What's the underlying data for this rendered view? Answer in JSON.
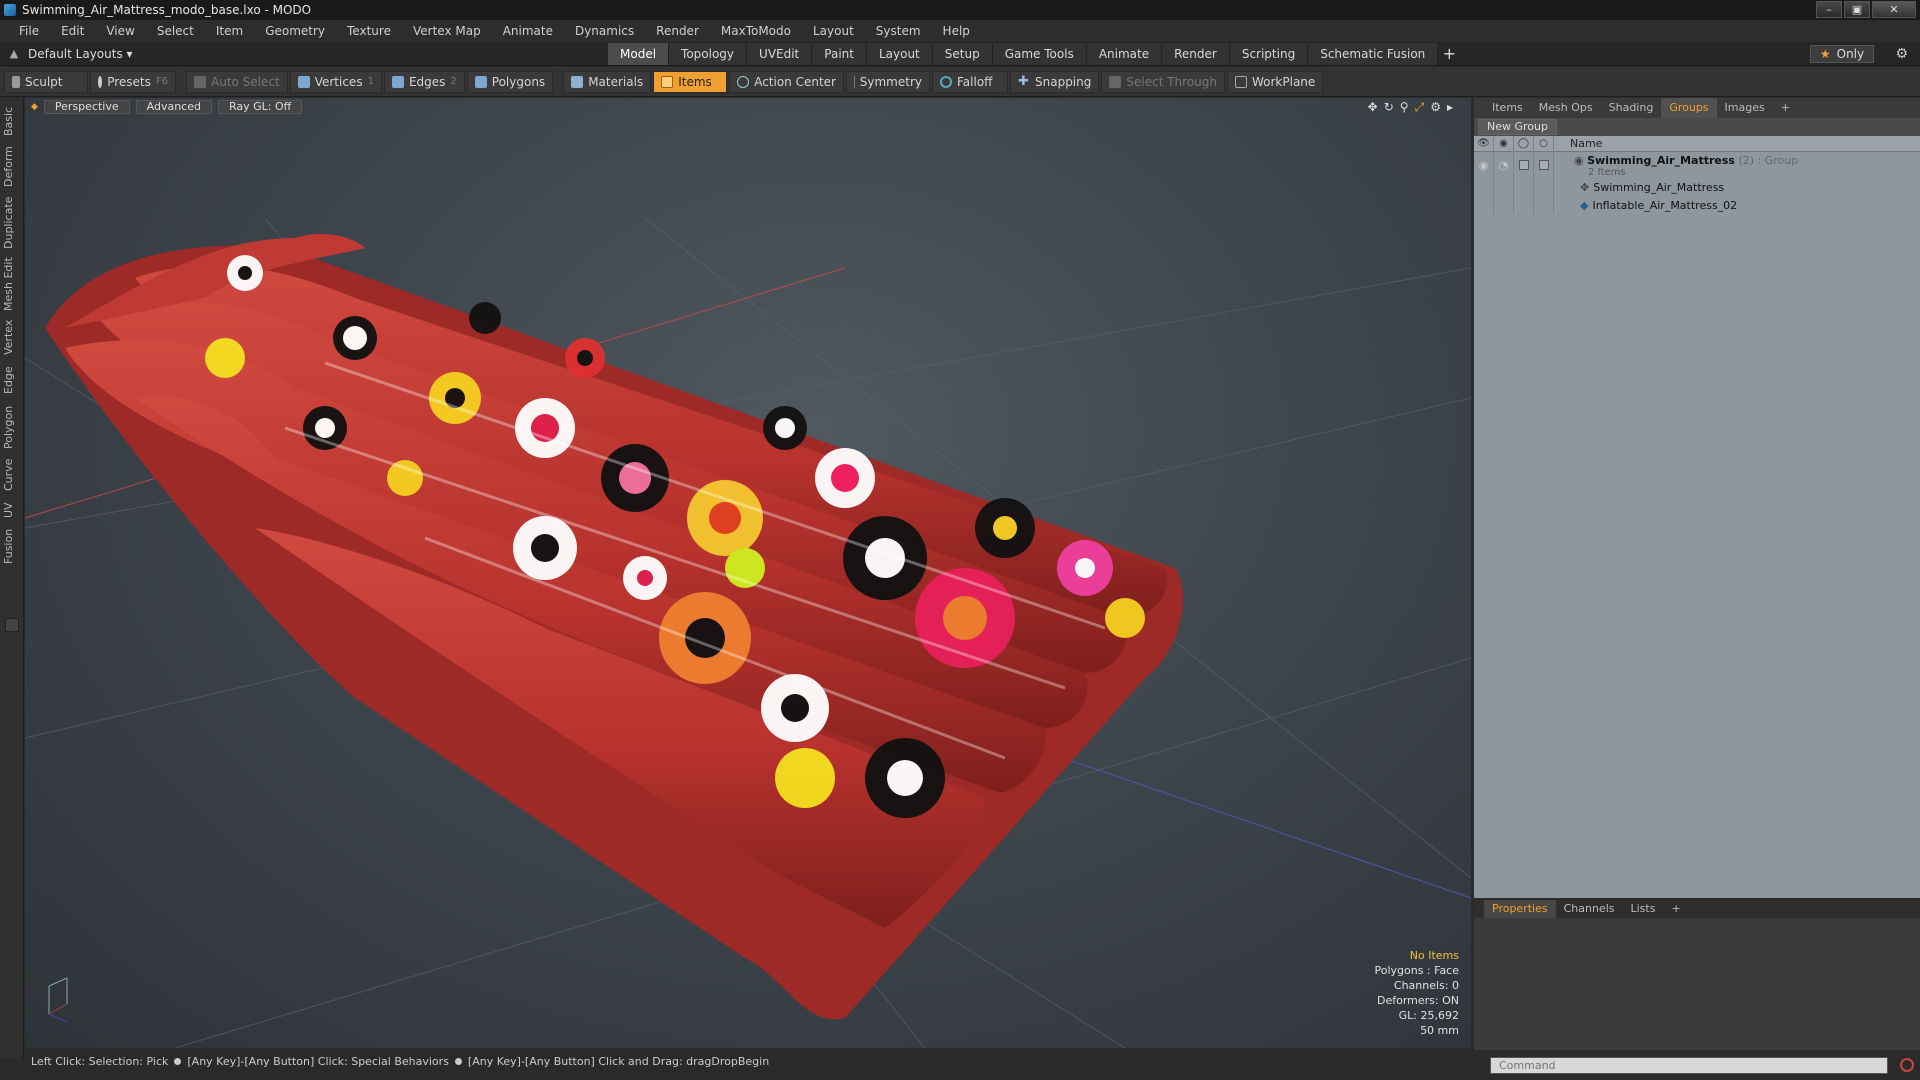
{
  "window": {
    "title": "Swimming_Air_Mattress_modo_base.lxo - MODO"
  },
  "menu": [
    "File",
    "Edit",
    "View",
    "Select",
    "Item",
    "Geometry",
    "Texture",
    "Vertex Map",
    "Animate",
    "Dynamics",
    "Render",
    "MaxToModo",
    "Layout",
    "System",
    "Help"
  ],
  "layoutbar": {
    "layout_select": "Default Layouts ▾",
    "tabs": [
      "Model",
      "Topology",
      "UVEdit",
      "Paint",
      "Layout",
      "Setup",
      "Game Tools",
      "Animate",
      "Render",
      "Scripting",
      "Schematic Fusion"
    ],
    "active_tab": "Model",
    "only_label": "Only"
  },
  "toolbar": {
    "sculpt": "Sculpt",
    "presets": "Presets",
    "presets_key": "F6",
    "auto_select": "Auto Select",
    "vertices": "Vertices",
    "vertices_key": "1",
    "edges": "Edges",
    "edges_key": "2",
    "polygons": "Polygons",
    "materials": "Materials",
    "items": "Items",
    "action_center": "Action Center",
    "symmetry": "Symmetry",
    "falloff": "Falloff",
    "snapping": "Snapping",
    "select_through": "Select Through",
    "workplane": "WorkPlane"
  },
  "left_tabs": [
    "Basic",
    "Deform",
    "Duplicate",
    "Mesh Edit",
    "Vertex",
    "Edge",
    "Polygon",
    "Curve",
    "UV",
    "Fusion"
  ],
  "viewport": {
    "view_mode": "Perspective",
    "shading": "Advanced",
    "raygl": "Ray GL: Off",
    "info": {
      "selection": "No Items",
      "polygons": "Polygons : Face",
      "channels": "Channels: 0",
      "deformers": "Deformers: ON",
      "gl": "GL: 25,692",
      "scale": "50 mm"
    }
  },
  "status": {
    "part1": "Left Click: Selection: Pick",
    "part2": "[Any Key]-[Any Button] Click: Special Behaviors",
    "part3": "[Any Key]-[Any Button] Click and Drag: dragDropBegin"
  },
  "right_panel": {
    "tabs": [
      "Items",
      "Mesh Ops",
      "Shading",
      "Groups",
      "Images"
    ],
    "active_tab": "Groups",
    "new_group": "New Group",
    "column_name": "Name",
    "group": {
      "name": "Swimming_Air_Mattress",
      "count": "(2)",
      "type": ": Group",
      "sub": "2 Items",
      "children": [
        "Swimming_Air_Mattress",
        "Inflatable_Air_Mattress_02"
      ]
    }
  },
  "bottom_panel": {
    "tabs": [
      "Properties",
      "Channels",
      "Lists"
    ],
    "active_tab": "Properties"
  },
  "command": {
    "placeholder": "Command"
  },
  "colors": {
    "accent": "#f0a030",
    "viewport_bg": "#3e454c",
    "mattress_red": "#b8322e"
  }
}
